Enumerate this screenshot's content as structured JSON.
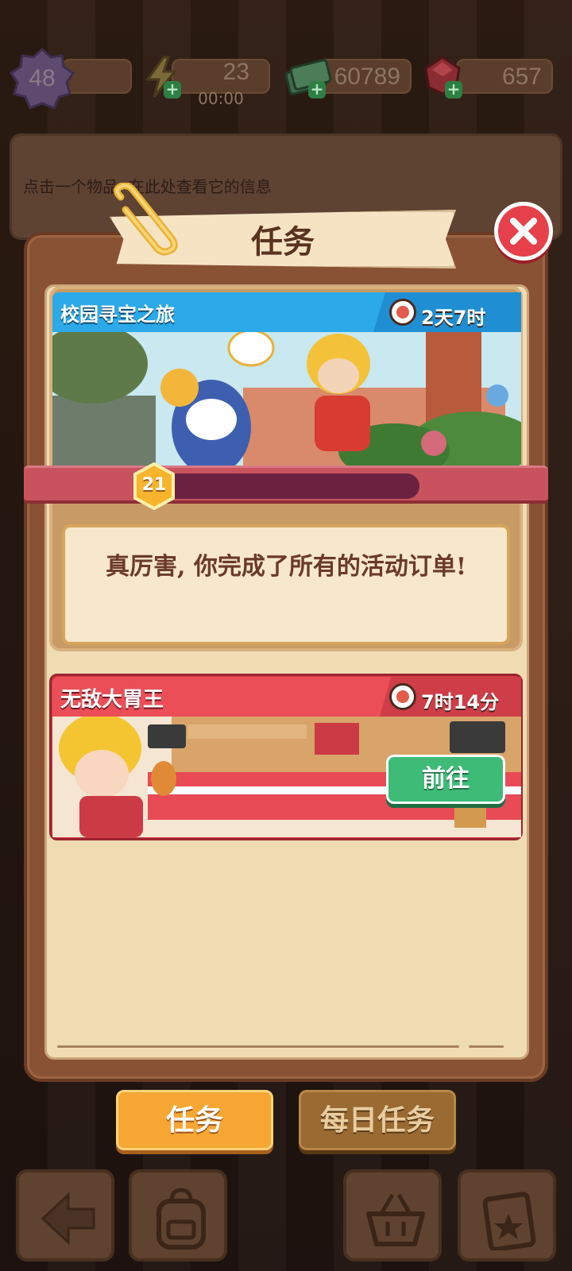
{
  "status_bar": {
    "level": "48",
    "energy": "23",
    "energy_timer": "00:00",
    "cash": "60789",
    "gems": "657"
  },
  "info_hint": "点击一个物品, 在此处查看它的信息",
  "dialog": {
    "title": "任务"
  },
  "events": [
    {
      "title": "校园寻宝之旅",
      "timer": "2天7时",
      "progress_level": "21",
      "progress_fraction": 0,
      "message": "真厉害, 你完成了所有的活动订单!",
      "header_color": "#2ba9e8"
    },
    {
      "title": "无敌大胃王",
      "timer": "7时14分",
      "go_label": "前往",
      "header_color": "#ec4e58"
    }
  ],
  "tabs": {
    "tasks": "任务",
    "daily": "每日任务"
  },
  "bottom_nav": [
    "back-arrow-icon",
    "backpack-icon",
    "basket-icon",
    "task-board-icon"
  ]
}
